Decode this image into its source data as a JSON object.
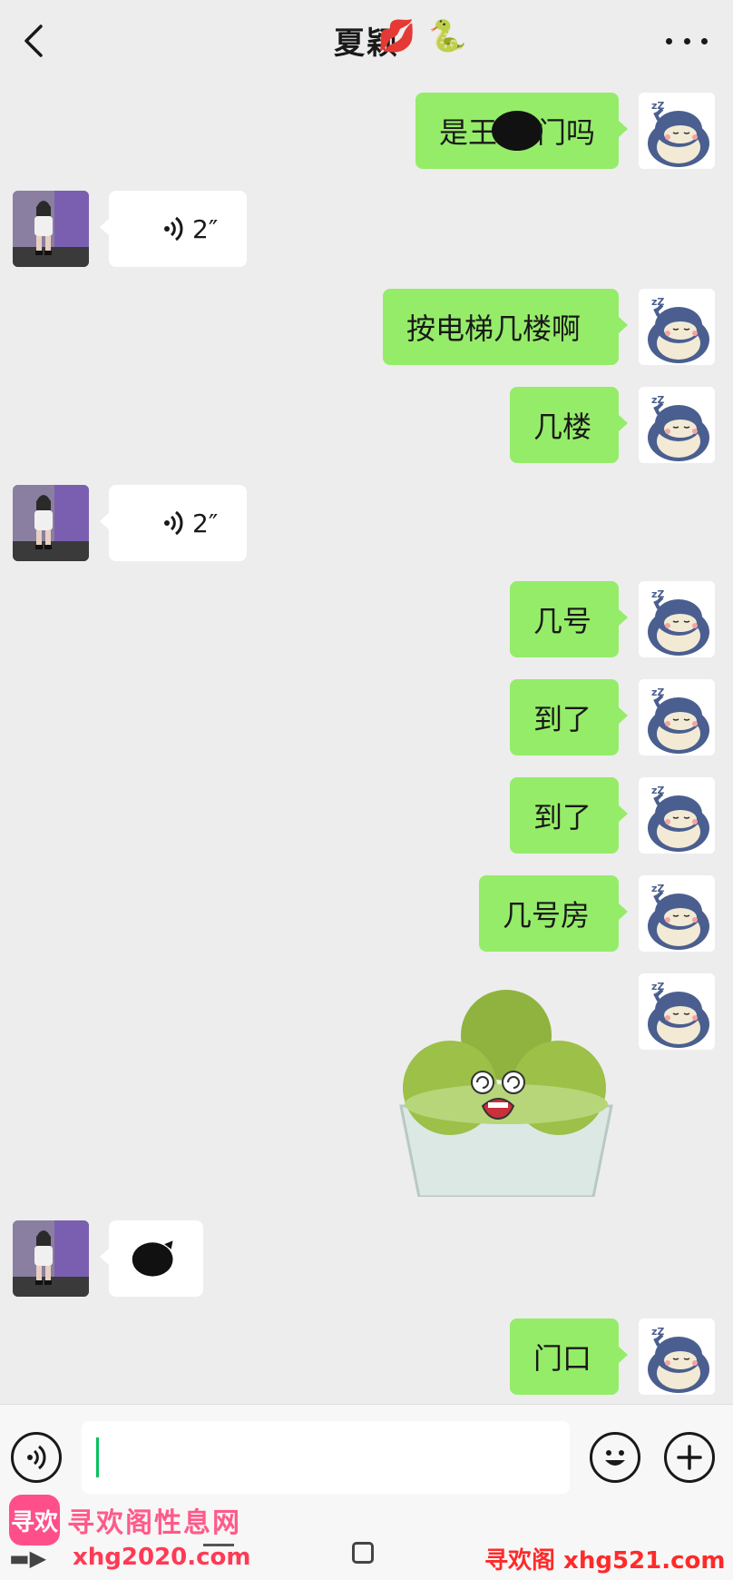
{
  "header": {
    "title": "夏颖",
    "title_emoji_1": "💋",
    "title_emoji_2": "🐍"
  },
  "messages": [
    {
      "side": "me",
      "prefix": "是王",
      "suffix": "门吗"
    },
    {
      "side": "them",
      "type": "voice",
      "duration": "2″"
    },
    {
      "side": "me",
      "text": "按电梯几楼啊"
    },
    {
      "side": "me",
      "text": "几楼"
    },
    {
      "side": "them",
      "type": "voice",
      "duration": "2″"
    },
    {
      "side": "me",
      "text": "几号"
    },
    {
      "side": "me",
      "text": "到了"
    },
    {
      "side": "me",
      "text": "到了"
    },
    {
      "side": "me",
      "text": "几号房"
    },
    {
      "side": "me",
      "type": "sticker"
    },
    {
      "side": "them",
      "type": "image"
    },
    {
      "side": "me",
      "text": "门口"
    }
  ],
  "input": {
    "value": ""
  },
  "watermark": {
    "logo": "寻欢",
    "text": "寻欢阁性息网",
    "url_left": "xhg2020.com",
    "url_right": "寻欢阁 xhg521.com"
  },
  "colors": {
    "bubble_me": "#95ec69",
    "bubble_them": "#ffffff",
    "background": "#ededed",
    "accent": "#07c160"
  }
}
